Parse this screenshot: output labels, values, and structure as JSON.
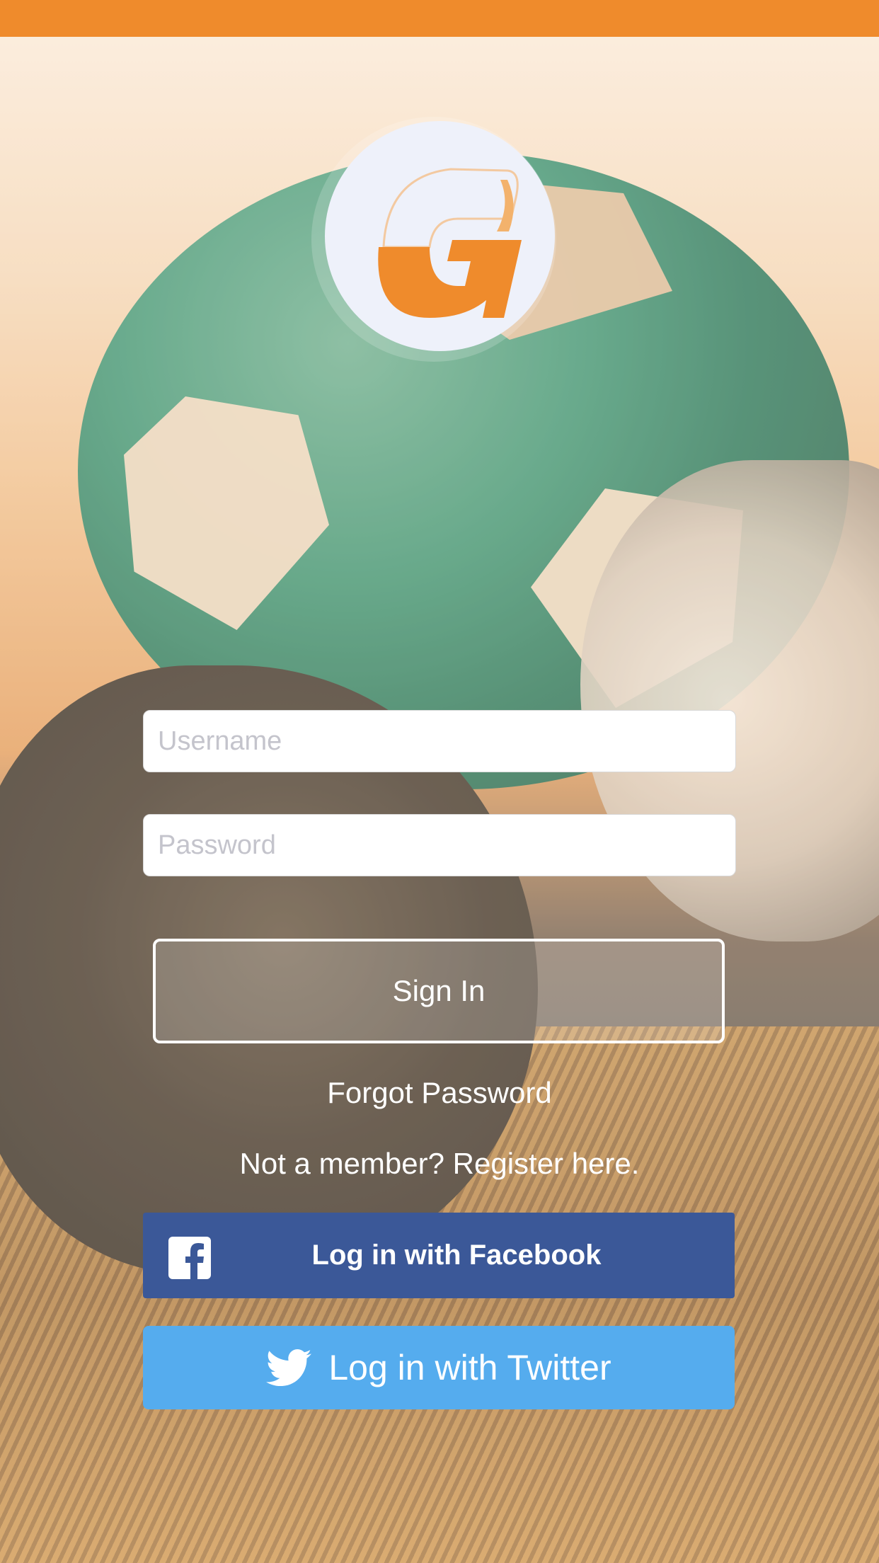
{
  "colors": {
    "accent": "#ef8b2c",
    "facebook": "#3b5898",
    "twitter": "#55acee"
  },
  "logo": {
    "icon": "g-logo-icon"
  },
  "login": {
    "username_placeholder": "Username",
    "password_placeholder": "Password",
    "signin_label": "Sign In",
    "forgot_label": "Forgot Password",
    "register_label": "Not a member? Register here."
  },
  "social": {
    "facebook_label": "Log in with Facebook",
    "facebook_icon": "facebook-icon",
    "twitter_label": "Log in with Twitter",
    "twitter_icon": "twitter-bird-icon"
  }
}
